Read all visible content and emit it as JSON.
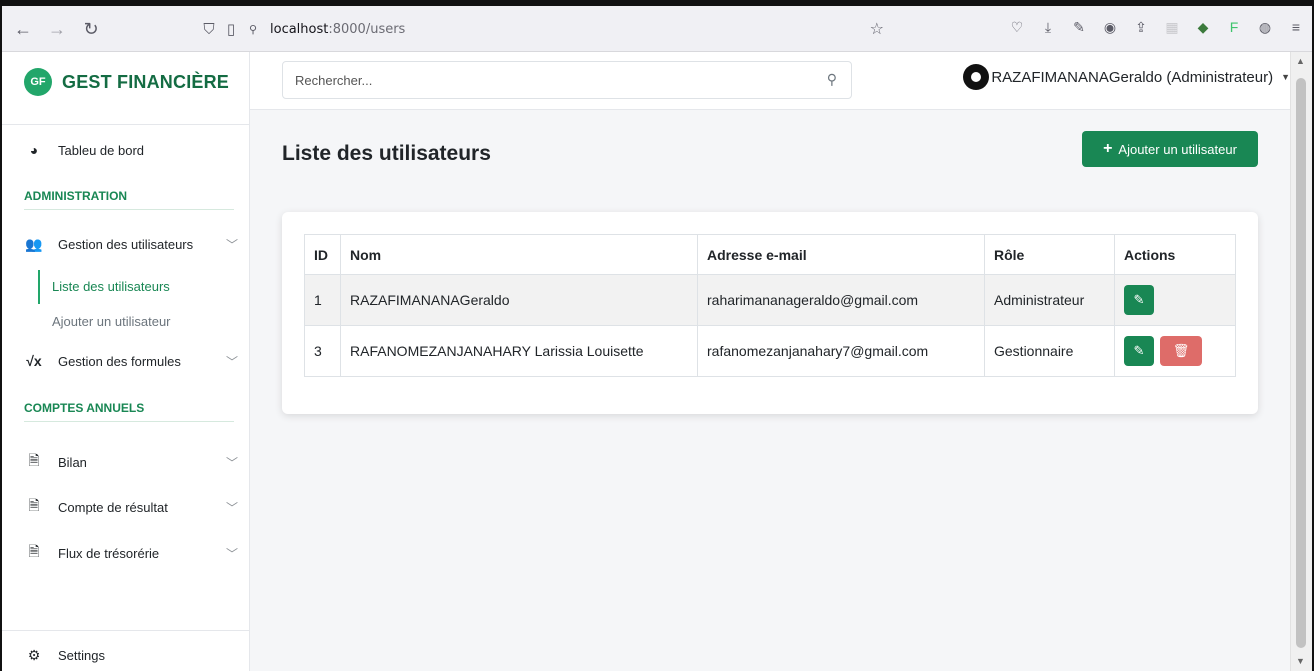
{
  "browser": {
    "url_host": "localhost",
    "url_path": ":8000/users"
  },
  "sidebar": {
    "brand_logo": "GF",
    "brand_name": "GEST FINANCIÈRE",
    "dashboard": "Tableu de bord",
    "section_admin": "ADMINISTRATION",
    "users_group": "Gestion des utilisateurs",
    "users_list": "Liste des utilisateurs",
    "users_add": "Ajouter un utilisateur",
    "formulas_group": "Gestion des formules",
    "section_accounts": "COMPTES ANNUELS",
    "bilan": "Bilan",
    "compte_resultat": "Compte de résultat",
    "flux": "Flux de trésorérie",
    "settings": "Settings"
  },
  "topbar": {
    "search_placeholder": "Rechercher...",
    "user_name": "RAZAFIMANANAGeraldo (Administrateur)"
  },
  "main": {
    "title": "Liste des utilisateurs",
    "add_button": "Ajouter un utilisateur",
    "columns": [
      "ID",
      "Nom",
      "Adresse e-mail",
      "Rôle",
      "Actions"
    ],
    "rows": [
      {
        "id": "1",
        "name": "RAZAFIMANANAGeraldo",
        "email": "raharimananageraldo@gmail.com",
        "role": "Administrateur"
      },
      {
        "id": "3",
        "name": "RAFANOMEZANJANAHARY Larissia Louisette",
        "email": "rafanomezanjanahary7@gmail.com",
        "role": "Gestionnaire"
      }
    ]
  },
  "colors": {
    "accent": "#198754",
    "danger": "#d9534f"
  }
}
